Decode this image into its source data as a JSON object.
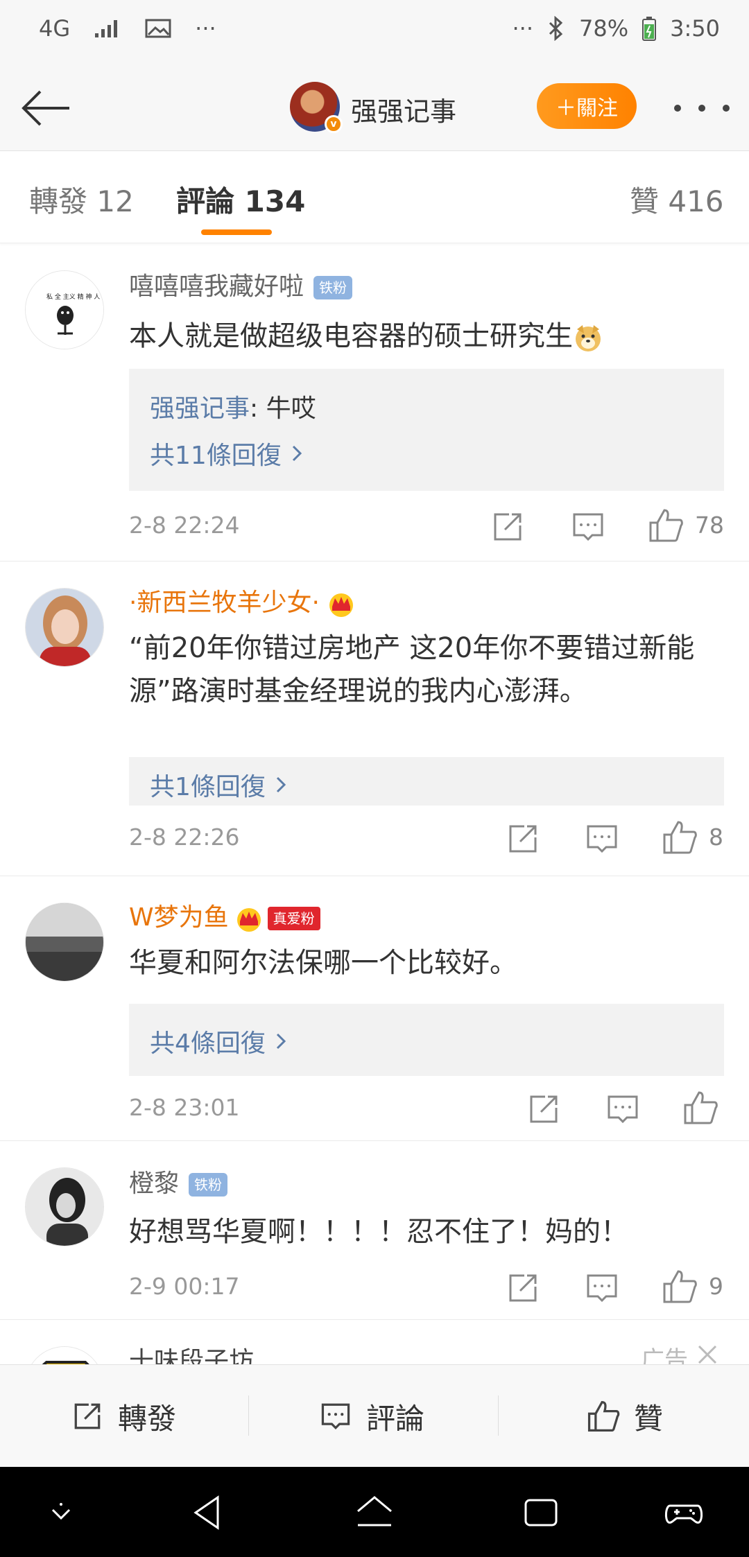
{
  "status_bar": {
    "network": "4G",
    "more_left": "···",
    "more_right": "···",
    "battery": "78%",
    "time": "3:50"
  },
  "header": {
    "title": "强强记事",
    "follow_label": "＋關注"
  },
  "tabs": {
    "repost": "轉發 12",
    "comments": "評論 134",
    "likes": "贊 416"
  },
  "comments": [
    {
      "name": "嘻嘻嘻我藏好啦",
      "badge": "铁粉",
      "text": "本人就是做超级电容器的硕士研究生",
      "reply_author": "强强记事",
      "reply_text": ": 牛哎",
      "reply_count": "共11條回復",
      "time": "2-8 22:24",
      "likes": "78"
    },
    {
      "name": "·新西兰牧羊少女·",
      "text": "“前20年你错过房地产 这20年你不要错过新能源”路演时基金经理说的我内心澎湃。",
      "reply_count": "共1條回復",
      "time": "2-8 22:26",
      "likes": "8"
    },
    {
      "name": "W梦为鱼",
      "badge": "真爱粉",
      "text": "华夏和阿尔法保哪一个比较好。",
      "reply_count": "共4條回復",
      "time": "2-8 23:01",
      "likes": ""
    },
    {
      "name": "橙黎",
      "badge": "铁粉",
      "text": "好想骂华夏啊！！！！忍不住了！妈的！",
      "time": "2-9 00:17",
      "likes": "9"
    },
    {
      "name": "十味段子坊",
      "ad_label": "广告"
    }
  ],
  "bottom_bar": {
    "repost": "轉發",
    "comment": "評論",
    "like": "贊"
  },
  "colors": {
    "accent": "#ff8200",
    "link": "#5b7ca8",
    "iron_badge": "#8fb3e0",
    "true_fan_badge": "#e0262d"
  }
}
